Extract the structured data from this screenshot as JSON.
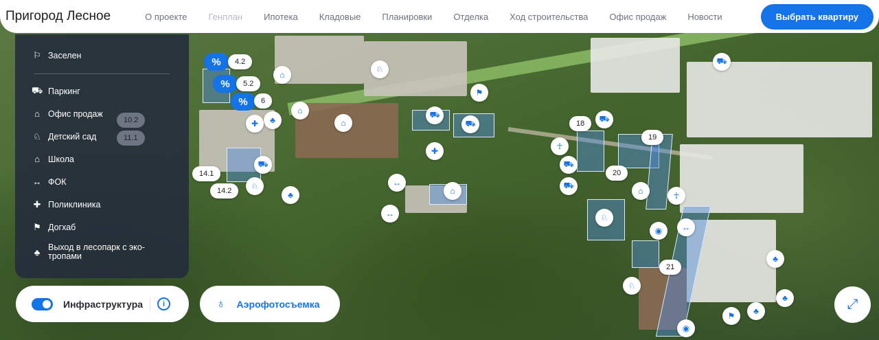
{
  "header": {
    "logo": "Пригород Лесное",
    "nav": [
      "О проекте",
      "Генплан",
      "Ипотека",
      "Кладовые",
      "Планировки",
      "Отделка",
      "Ход строительства",
      "Офис продаж",
      "Новости"
    ],
    "active_nav": "Генплан",
    "cta": "Выбрать квартиру"
  },
  "legend": {
    "top_item": {
      "icon": "flag-icon",
      "label": "Заселен"
    },
    "items": [
      {
        "icon": "car-icon",
        "label": "Паркинг"
      },
      {
        "icon": "office-icon",
        "label": "Офис продаж"
      },
      {
        "icon": "kindergarten-icon",
        "label": "Детский сад"
      },
      {
        "icon": "school-icon",
        "label": "Школа"
      },
      {
        "icon": "fitness-icon",
        "label": "ФОК"
      },
      {
        "icon": "clinic-icon",
        "label": "Поликлиника"
      },
      {
        "icon": "dog-icon",
        "label": "Догхаб"
      },
      {
        "icon": "forest-icon",
        "label": "Выход в лесопарк с эко-тропами"
      }
    ]
  },
  "controls": {
    "infra_label": "Инфраструктура",
    "infra_on": true,
    "aerial_label": "Аэрофотосъемка"
  },
  "map": {
    "percent_symbol": "%",
    "building_labels": [
      "4.2",
      "5.2",
      "6",
      "10.2",
      "11.1",
      "14.1",
      "14.2",
      "18",
      "19",
      "20",
      "21"
    ]
  },
  "colors": {
    "accent": "#1473e6",
    "panel": "#252c3c"
  }
}
